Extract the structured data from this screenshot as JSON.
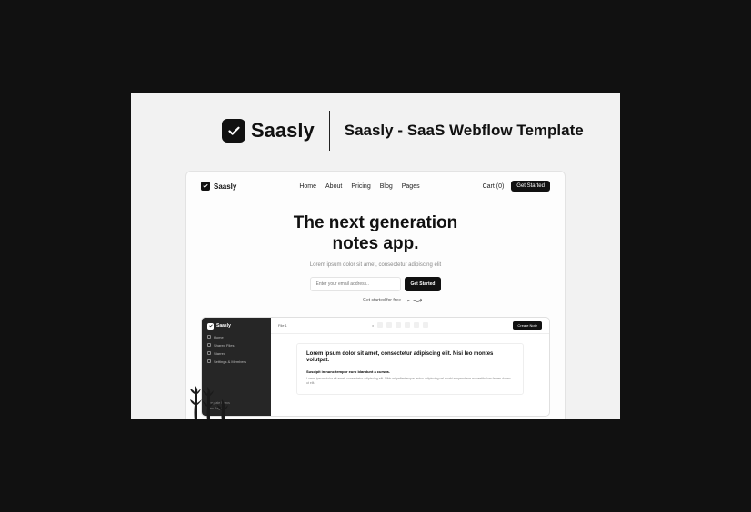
{
  "brand": {
    "name": "Saasly",
    "tagline": "Saasly - SaaS Webflow Template"
  },
  "nav": {
    "items": [
      "Home",
      "About",
      "Pricing",
      "Blog",
      "Pages"
    ],
    "cart": "Cart (0)",
    "cta": "Get Started"
  },
  "hero": {
    "title_l1": "The next generation",
    "title_l2": "notes app.",
    "subtitle": "Lorem ipsum dolor sit amet, consectetur adipiscing elit",
    "placeholder": "Enter your email address..",
    "cta": "Get Started",
    "free_label": "Get started for free"
  },
  "app": {
    "side_items": [
      "Home",
      "Shared Files",
      "Starred",
      "Settings & Members"
    ],
    "toolbar_file": "File 1",
    "create": "Create Note",
    "doc_title": "Lorem ipsum dolor sit amet, consectetur adipiscing elit. Nisi leo montes volutpat.",
    "doc_sub": "Suscipit in nunc tempor euro blandunt a cursus.",
    "doc_body": "Lorem ipsum dolor sit amet, consectetur adipiscing elit. Nibh mi pellentesque lectus adipiscing vel morbi suspendisse eu vestibulum fames donec ut elit."
  },
  "app_bottom": [
    "Template Specs",
    "New Page"
  ]
}
